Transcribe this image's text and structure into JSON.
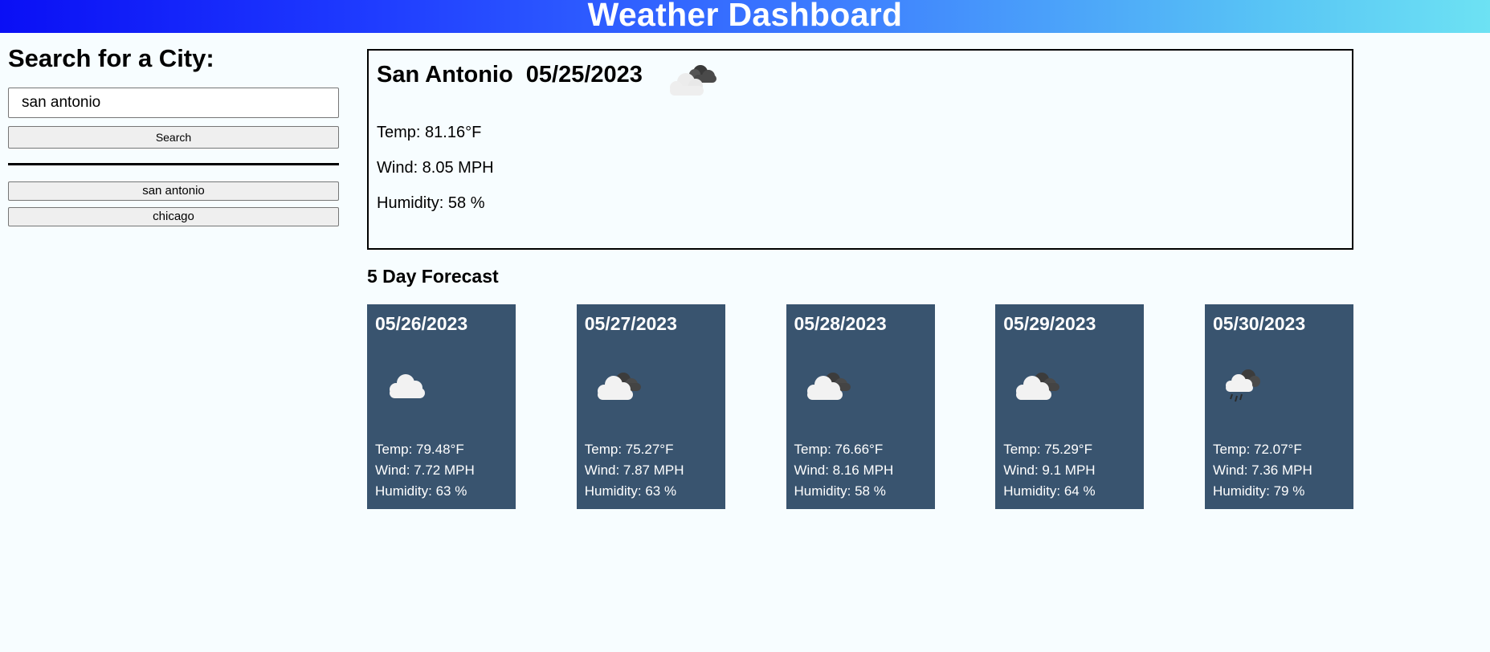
{
  "header": {
    "title": "Weather Dashboard"
  },
  "sidebar": {
    "title": "Search for a City:",
    "search_value": "san antonio",
    "search_button": "Search",
    "history": [
      "san antonio",
      "chicago"
    ]
  },
  "current": {
    "title": "San Antonio  05/25/2023",
    "icon": "partly-cloudy-icon",
    "temp": "Temp: 81.16°F",
    "wind": "Wind: 8.05 MPH",
    "humidity": "Humidity: 58 %"
  },
  "forecast": {
    "title": "5 Day Forecast",
    "days": [
      {
        "date": "05/26/2023",
        "icon": "cloud-icon",
        "temp": "Temp: 79.48°F",
        "wind": "Wind: 7.72 MPH",
        "humidity": "Humidity: 63 %"
      },
      {
        "date": "05/27/2023",
        "icon": "broken-clouds-icon",
        "temp": "Temp: 75.27°F",
        "wind": "Wind: 7.87 MPH",
        "humidity": "Humidity: 63 %"
      },
      {
        "date": "05/28/2023",
        "icon": "broken-clouds-icon",
        "temp": "Temp: 76.66°F",
        "wind": "Wind: 8.16 MPH",
        "humidity": "Humidity: 58 %"
      },
      {
        "date": "05/29/2023",
        "icon": "broken-clouds-icon",
        "temp": "Temp: 75.29°F",
        "wind": "Wind: 9.1 MPH",
        "humidity": "Humidity: 64 %"
      },
      {
        "date": "05/30/2023",
        "icon": "rain-cloud-icon",
        "temp": "Temp: 72.07°F",
        "wind": "Wind: 7.36 MPH",
        "humidity": "Humidity: 79 %"
      }
    ]
  },
  "colors": {
    "header_gradient_start": "#0a0ff5",
    "header_gradient_end": "#6de2f3",
    "card_background": "#39546f",
    "page_background": "#f7fdff"
  }
}
